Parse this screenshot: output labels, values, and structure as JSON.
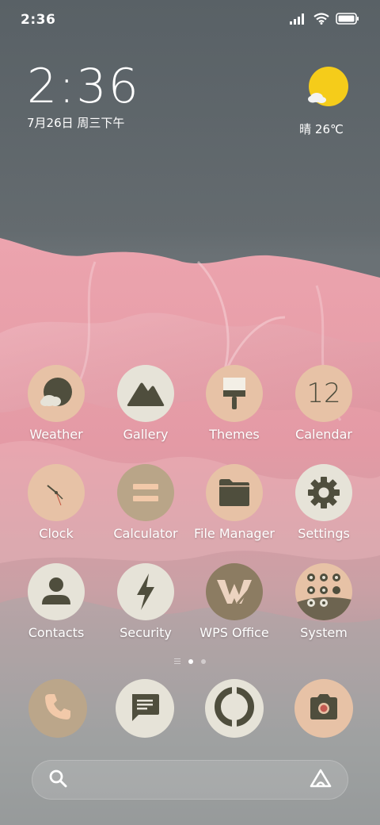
{
  "status_bar": {
    "time": "2:36",
    "icons": [
      "signal-icon",
      "wifi-icon",
      "battery-icon"
    ]
  },
  "clock_widget": {
    "time": "2:36",
    "date": "7月26日 周三下午"
  },
  "weather_widget": {
    "icon": "sun-cloud-icon",
    "text": "晴 26℃"
  },
  "apps": [
    {
      "id": "weather",
      "label": "Weather",
      "icon": "weather-icon"
    },
    {
      "id": "gallery",
      "label": "Gallery",
      "icon": "mountain-icon"
    },
    {
      "id": "themes",
      "label": "Themes",
      "icon": "paintbrush-icon"
    },
    {
      "id": "calendar",
      "label": "Calendar",
      "icon": "calendar-icon",
      "value": "12"
    },
    {
      "id": "clock",
      "label": "Clock",
      "icon": "clock-icon"
    },
    {
      "id": "calculator",
      "label": "Calculator",
      "icon": "equals-icon"
    },
    {
      "id": "file-manager",
      "label": "File Manager",
      "icon": "folder-icon"
    },
    {
      "id": "settings",
      "label": "Settings",
      "icon": "gear-icon"
    },
    {
      "id": "contacts",
      "label": "Contacts",
      "icon": "person-icon"
    },
    {
      "id": "security",
      "label": "Security",
      "icon": "lightning-icon"
    },
    {
      "id": "wps-office",
      "label": "WPS Office",
      "icon": "wps-icon"
    },
    {
      "id": "system",
      "label": "System",
      "icon": "folder-grid-icon"
    }
  ],
  "page_indicator": {
    "pages": 2,
    "active": 1
  },
  "dock": [
    {
      "id": "phone",
      "icon": "phone-icon"
    },
    {
      "id": "messages",
      "icon": "message-icon"
    },
    {
      "id": "browser",
      "icon": "browser-icon"
    },
    {
      "id": "camera",
      "icon": "camera-icon"
    }
  ],
  "search_bar": {
    "left_icon": "search-icon",
    "right_icon": "assistant-icon"
  },
  "colors": {
    "sky": "#5f676b",
    "mountain_pink": "#e8a3ad",
    "icon_peach": "#e7c2a6",
    "icon_cream": "#e6e3d8",
    "icon_tan": "#bba68a",
    "icon_dark": "#4f4e3d"
  }
}
